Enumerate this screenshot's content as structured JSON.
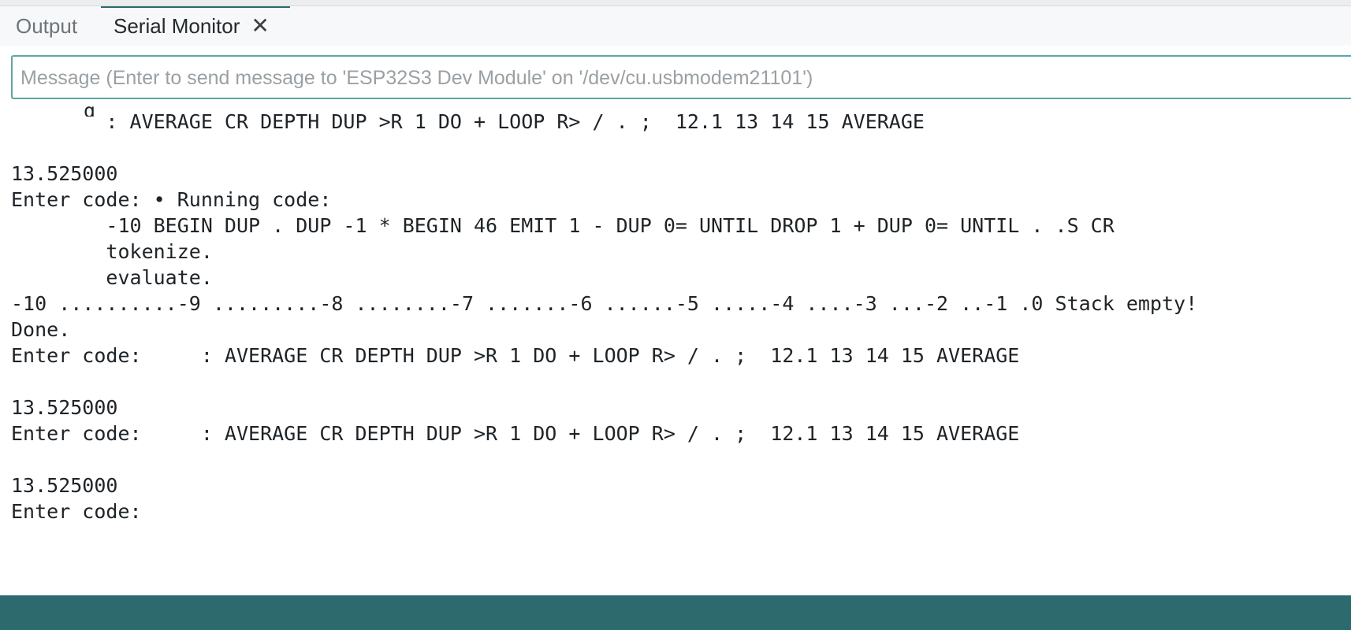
{
  "tabs": {
    "output_label": "Output",
    "serial_monitor_label": "Serial Monitor",
    "close_glyph": "✕"
  },
  "message": {
    "placeholder": "Message (Enter to send message to 'ESP32S3 Dev Module' on '/dev/cu.usbmodem21101')",
    "value": ""
  },
  "output": {
    "cut_fragment": "g",
    "lines": [
      "        : AVERAGE CR DEPTH DUP >R 1 DO + LOOP R> / . ;  12.1 13 14 15 AVERAGE",
      "",
      "13.525000",
      "Enter code: • Running code:",
      "        -10 BEGIN DUP . DUP -1 * BEGIN 46 EMIT 1 - DUP 0= UNTIL DROP 1 + DUP 0= UNTIL . .S CR",
      "        tokenize.",
      "        evaluate.",
      "-10 ..........-9 .........-8 ........-7 .......-6 ......-5 .....-4 ....-3 ...-2 ..-1 .0 Stack empty!",
      "Done.",
      "Enter code:     : AVERAGE CR DEPTH DUP >R 1 DO + LOOP R> / . ;  12.1 13 14 15 AVERAGE",
      "",
      "13.525000",
      "Enter code:     : AVERAGE CR DEPTH DUP >R 1 DO + LOOP R> / . ;  12.1 13 14 15 AVERAGE",
      "",
      "13.525000",
      "Enter code:"
    ]
  },
  "colors": {
    "accent": "#2d6a6e",
    "input_border": "#5fa6a6"
  }
}
